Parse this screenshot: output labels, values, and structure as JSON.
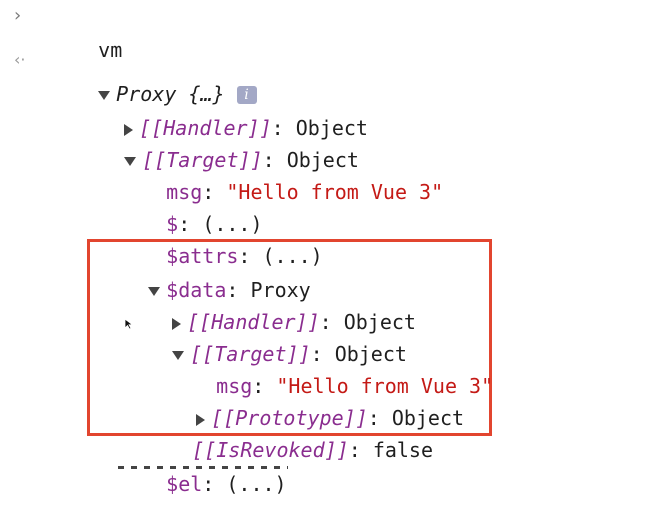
{
  "prompt": {
    "caret": "›",
    "command": "vm"
  },
  "result": {
    "return_glyph": "‹·",
    "label": "Proxy {…}",
    "info_badge": "i"
  },
  "tree": {
    "handler": {
      "key": "[[Handler]]",
      "sep": ": ",
      "value": "Object"
    },
    "target": {
      "key": "[[Target]]",
      "sep": ": ",
      "value": "Object"
    },
    "msg": {
      "key": "msg",
      "sep": ": ",
      "value": "\"Hello from Vue 3\""
    },
    "dollar": {
      "key": "$",
      "sep": ": ",
      "value": "(...)"
    },
    "attrs": {
      "key": "$attrs",
      "sep": ": ",
      "value": "(...)"
    },
    "data": {
      "key": "$data",
      "sep": ": ",
      "value": "Proxy",
      "handler": {
        "key": "[[Handler]]",
        "sep": ": ",
        "value": "Object"
      },
      "target": {
        "key": "[[Target]]",
        "sep": ": ",
        "value": "Object"
      },
      "msg": {
        "key": "msg",
        "sep": ": ",
        "value": "\"Hello from Vue 3\""
      },
      "prototype": {
        "key": "[[Prototype]]",
        "sep": ": ",
        "value": "Object"
      },
      "revoked": {
        "key": "[[IsRevoked]]",
        "sep": ": ",
        "value": "false"
      }
    },
    "el": {
      "key": "$el",
      "sep": ": ",
      "value": "(...)"
    }
  },
  "colors": {
    "property_key": "#8a2d8f",
    "string_value": "#c41a16",
    "highlight_border": "#e2452f",
    "info_badge_bg": "#a3a8c6"
  }
}
